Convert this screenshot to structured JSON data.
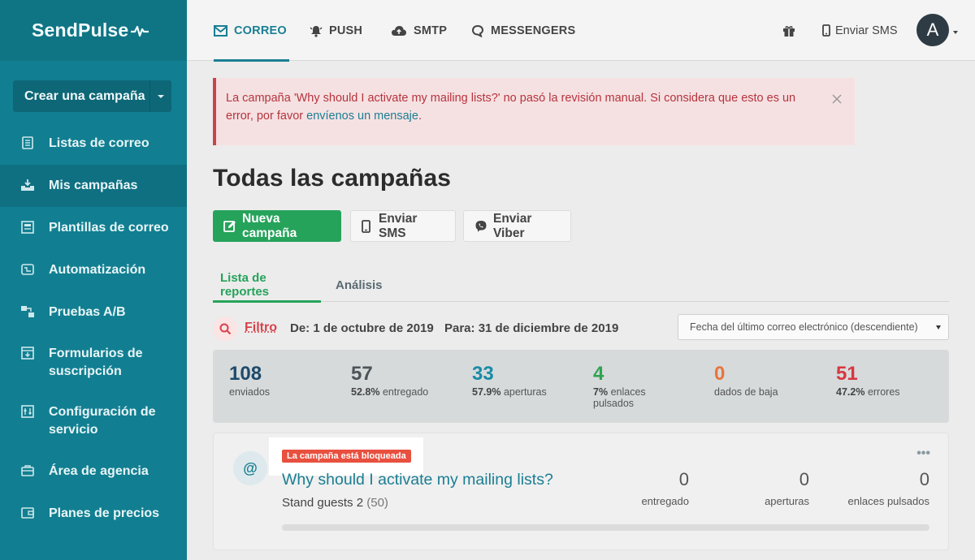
{
  "sidebar": {
    "logo": "SendPulse",
    "create_campaign": "Crear una campaña",
    "items": [
      {
        "label": "Listas de correo",
        "icon": "list-icon"
      },
      {
        "label": "Mis campañas",
        "icon": "campaigns-icon"
      },
      {
        "label": "Plantillas de correo",
        "icon": "templates-icon"
      },
      {
        "label": "Automatización",
        "icon": "automation-icon"
      },
      {
        "label": "Pruebas A/B",
        "icon": "ab-test-icon"
      },
      {
        "label": "Formularios de suscripción",
        "icon": "form-icon"
      },
      {
        "label": "Configuración de servicio",
        "icon": "settings-icon"
      },
      {
        "label": "Área de agencia",
        "icon": "briefcase-icon"
      },
      {
        "label": "Planes de precios",
        "icon": "wallet-icon"
      }
    ]
  },
  "topbar": {
    "tabs": [
      {
        "label": "CORREO",
        "icon": "mail-icon"
      },
      {
        "label": "PUSH",
        "icon": "bell-icon"
      },
      {
        "label": "SMTP",
        "icon": "cloud-icon"
      },
      {
        "label": "MESSENGERS",
        "icon": "chat-icon"
      }
    ],
    "send_sms": "Enviar SMS",
    "avatar_letter": "A"
  },
  "alert": {
    "text": "La campaña 'Why should I activate my mailing lists?' no pasó la revisión manual. Si considera que esto es un error, por favor ",
    "link": "envíenos un mensaje",
    "end": "."
  },
  "main": {
    "title": "Todas las campañas",
    "buttons": {
      "new_campaign": "Nueva campaña",
      "send_sms": "Enviar SMS",
      "send_viber": "Enviar Viber"
    },
    "subtabs": {
      "reports": "Lista de reportes",
      "analysis": "Análisis"
    },
    "filter": {
      "label": "Filtro",
      "from": "De: 1 de octubre de 2019",
      "to": "Para: 31 de diciembre de 2019",
      "sort": "Fecha del último correo electrónico (descendiente)"
    }
  },
  "stats": [
    {
      "value": "108",
      "pct": "",
      "label": "enviados",
      "color": "#1e4a6b"
    },
    {
      "value": "57",
      "pct": "52.8%",
      "label": "entregado",
      "color": "#4c5458"
    },
    {
      "value": "33",
      "pct": "57.9%",
      "label": "aperturas",
      "color": "#1a8aa6"
    },
    {
      "value": "4",
      "pct": "7%",
      "label": "enlaces pulsados",
      "color": "#2fa34f"
    },
    {
      "value": "0",
      "pct": "",
      "label": "dados de baja",
      "color": "#e9743b"
    },
    {
      "value": "51",
      "pct": "47.2%",
      "label": "errores",
      "color": "#d8363f"
    }
  ],
  "campaign": {
    "badge": "La campaña está bloqueada",
    "title": "Why should I activate my mailing lists?",
    "list": "Stand guests 2",
    "count": "(50)",
    "dots": "•••",
    "metrics": [
      {
        "value": "0",
        "label": "entregado"
      },
      {
        "value": "0",
        "label": "aperturas"
      },
      {
        "value": "0",
        "label": "enlaces pulsados"
      }
    ]
  },
  "colors": {
    "sidebar": "#117f91",
    "accent": "#1a7e93",
    "green": "#26a35b",
    "danger": "#d6434b"
  }
}
